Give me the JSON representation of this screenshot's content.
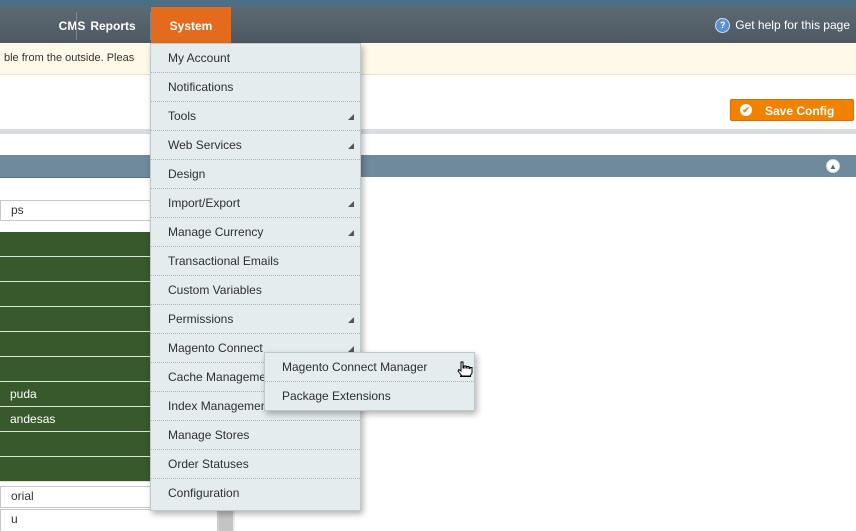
{
  "nav": {
    "items": [
      {
        "label": "CMS"
      },
      {
        "label": "Reports"
      },
      {
        "label": "System"
      }
    ],
    "help": {
      "icon": "help-icon",
      "label": "Get help for this page"
    }
  },
  "notice": {
    "text": "ble from the outside. Pleas"
  },
  "toolbar": {
    "save_label": "Save Config",
    "save_icon": "checkmark-icon"
  },
  "left_panel": {
    "input_top_value": "ps",
    "green_rows": [
      "",
      "",
      "",
      "",
      "",
      "",
      "puda",
      "andesas",
      "",
      ""
    ],
    "input_bottom_value": "orial",
    "input_partial_value": "u"
  },
  "system_menu": {
    "items": [
      {
        "label": "My Account",
        "has_submenu": false
      },
      {
        "label": "Notifications",
        "has_submenu": false
      },
      {
        "label": "Tools",
        "has_submenu": true
      },
      {
        "label": "Web Services",
        "has_submenu": true
      },
      {
        "label": "Design",
        "has_submenu": false
      },
      {
        "label": "Import/Export",
        "has_submenu": true
      },
      {
        "label": "Manage Currency",
        "has_submenu": true
      },
      {
        "label": "Transactional Emails",
        "has_submenu": false
      },
      {
        "label": "Custom Variables",
        "has_submenu": false
      },
      {
        "label": "Permissions",
        "has_submenu": true
      },
      {
        "label": "Magento Connect",
        "has_submenu": true
      },
      {
        "label": "Cache Management",
        "has_submenu": false
      },
      {
        "label": "Index Management",
        "has_submenu": false
      },
      {
        "label": "Manage Stores",
        "has_submenu": false
      },
      {
        "label": "Order Statuses",
        "has_submenu": false
      },
      {
        "label": "Configuration",
        "has_submenu": false
      }
    ]
  },
  "connect_submenu": {
    "items": [
      {
        "label": "Magento Connect Manager"
      },
      {
        "label": "Package Extensions"
      }
    ]
  },
  "colors": {
    "nav_active": "#e46b1e",
    "save_button": "#f18200",
    "section_header": "#6f8a9d",
    "green_rows": "#37592b",
    "menu_background": "#e4ecee"
  }
}
